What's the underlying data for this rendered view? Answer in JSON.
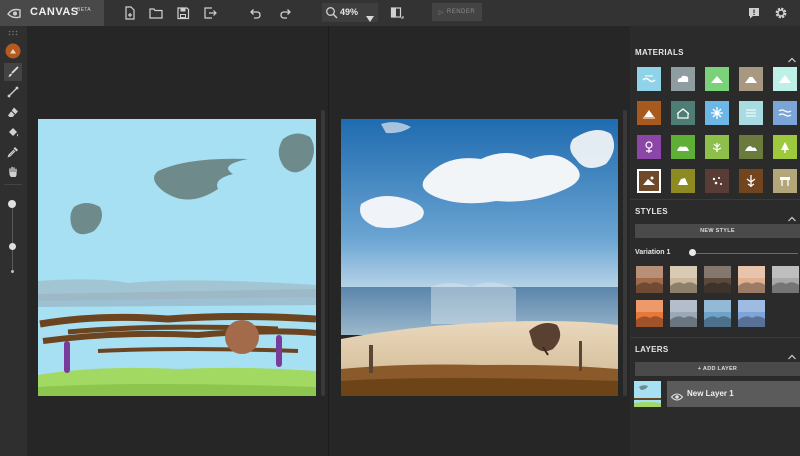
{
  "header": {
    "app_name": "CANVAS",
    "beta_tag": "BETA",
    "zoom_value": "49%",
    "render_label": "RENDER"
  },
  "toolbar_icons": [
    "new-file-icon",
    "open-folder-icon",
    "save-icon",
    "export-icon",
    "undo-icon",
    "redo-icon",
    "zoom-icon",
    "zoom-dropdown-icon",
    "compare-view-icon",
    "feedback-icon",
    "settings-icon"
  ],
  "left_tools": [
    "brush-color-swatch",
    "paint-brush-icon",
    "line-tool-icon",
    "eraser-icon",
    "fill-bucket-icon",
    "eyedropper-icon",
    "pan-hand-icon",
    "brush-size-slider"
  ],
  "panel": {
    "materials_title": "MATERIALS",
    "styles_title": "STYLES",
    "new_style_label": "NEW STYLE",
    "variation_label": "Variation 1",
    "variation_level": 0.05,
    "layers_title": "LAYERS",
    "add_layer_label": "+ ADD LAYER",
    "layer_name": "New Layer 1"
  },
  "materials": [
    {
      "name": "sea",
      "color": "#8fd3e8"
    },
    {
      "name": "cloud",
      "color": "#8f9da1"
    },
    {
      "name": "grass",
      "color": "#7ad17a"
    },
    {
      "name": "mountain",
      "color": "#a89880"
    },
    {
      "name": "snow",
      "color": "#bdf0e6"
    },
    {
      "name": "sand",
      "color": "#a85a1e"
    },
    {
      "name": "building",
      "color": "#4e7d76"
    },
    {
      "name": "snowflake",
      "color": "#6db7e7"
    },
    {
      "name": "fog",
      "color": "#a9dbe3"
    },
    {
      "name": "water",
      "color": "#7aa5d6"
    },
    {
      "name": "flower",
      "color": "#8c46a8"
    },
    {
      "name": "bush",
      "color": "#5fae35"
    },
    {
      "name": "plant",
      "color": "#8ebf4b"
    },
    {
      "name": "hill",
      "color": "#6b7a3d"
    },
    {
      "name": "tree",
      "color": "#9ec93f"
    },
    {
      "name": "dirt",
      "color": "#6e4a2a"
    },
    {
      "name": "rock",
      "color": "#8c8a20"
    },
    {
      "name": "gravel",
      "color": "#5a3c36"
    },
    {
      "name": "wood",
      "color": "#73451e"
    },
    {
      "name": "road",
      "color": "#b3a77a"
    }
  ],
  "style_thumbs": [
    "#a16a4a",
    "#cbb89a",
    "#5a4a3e",
    "#e0b090",
    "#a8a8a8",
    "#e6783a",
    "#9aa8b8",
    "#6fa2c8",
    "#7ea4d8"
  ]
}
